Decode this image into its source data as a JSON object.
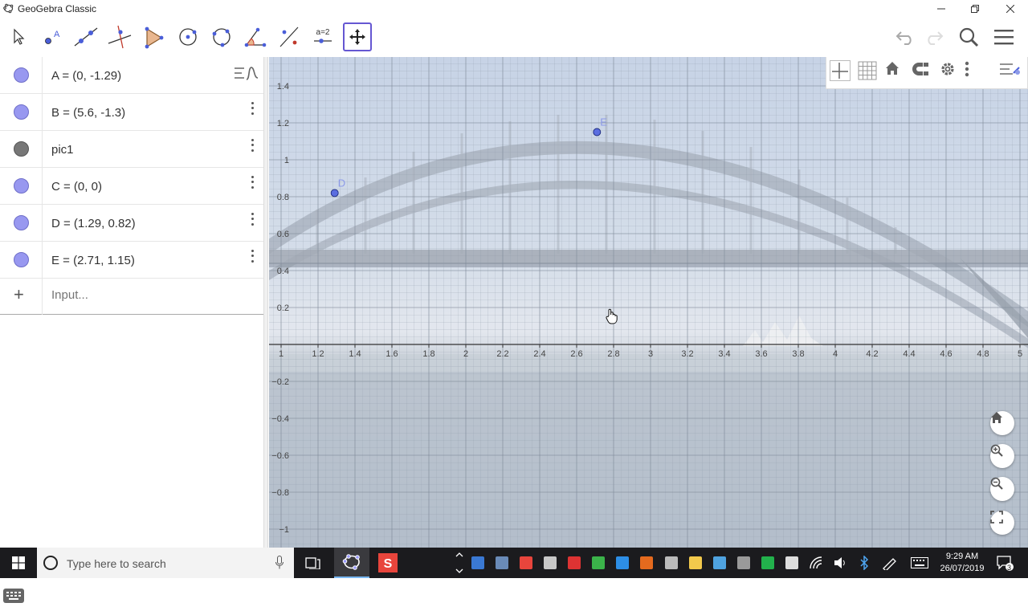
{
  "window": {
    "title": "GeoGebra Classic"
  },
  "toolbar": {
    "tools": [
      "move-tool",
      "point-tool",
      "line-tool",
      "perpendicular-line-tool",
      "polygon-tool",
      "circle-center-point-tool",
      "circle-three-points-tool",
      "angle-tool",
      "reflect-tool",
      "slider-tool",
      "move-graphics-view-tool"
    ],
    "slider_label": "a=2",
    "active_tool": "move-graphics-view-tool"
  },
  "algebra": {
    "items": [
      {
        "name": "A",
        "text": "A = (0, -1.29)",
        "color": "#9898f0",
        "menu": false
      },
      {
        "name": "B",
        "text": "B = (5.6, -1.3)",
        "color": "#9898f0",
        "menu": true
      },
      {
        "name": "pic1",
        "text": "pic1",
        "color": "#777777",
        "menu": true
      },
      {
        "name": "C",
        "text": "C = (0, 0)",
        "color": "#9898f0",
        "menu": true
      },
      {
        "name": "D",
        "text": "D = (1.29, 0.82)",
        "color": "#9898f0",
        "menu": true
      },
      {
        "name": "E",
        "text": "E = (2.71, 1.15)",
        "color": "#9898f0",
        "menu": true
      }
    ],
    "input_placeholder": "Input..."
  },
  "graphics": {
    "x_ticks": [
      "1",
      "1.2",
      "1.4",
      "1.6",
      "1.8",
      "2",
      "2.2",
      "2.4",
      "2.6",
      "2.8",
      "3",
      "3.2",
      "3.4",
      "3.6",
      "3.8",
      "4",
      "4.2",
      "4.4",
      "4.6",
      "4.8",
      "5"
    ],
    "y_ticks_pos": [
      "1.4",
      "1.2",
      "1",
      "0.8",
      "0.6",
      "0.4",
      "0.2"
    ],
    "y_ticks_neg": [
      "−0.2",
      "−0.4",
      "−0.6",
      "−0.8",
      "−1"
    ],
    "x_range": [
      1,
      5.1
    ],
    "y_range": [
      -1.05,
      1.6
    ],
    "grid": true,
    "points": [
      {
        "label": "D",
        "x": 1.29,
        "y": 0.82
      },
      {
        "label": "E",
        "x": 2.71,
        "y": 1.15
      }
    ],
    "point_color": "#5b6ee0"
  },
  "taskbar": {
    "search_placeholder": "Type here to search",
    "time": "9:29 AM",
    "date": "26/07/2019",
    "notification_count": "3"
  }
}
